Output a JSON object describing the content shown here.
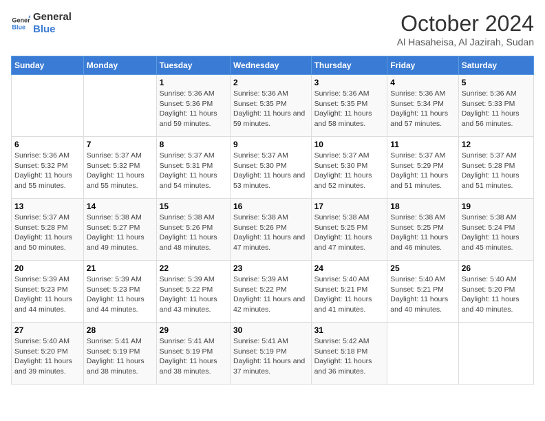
{
  "logo": {
    "line1": "General",
    "line2": "Blue"
  },
  "title": "October 2024",
  "subtitle": "Al Hasaheisa, Al Jazirah, Sudan",
  "columns": [
    "Sunday",
    "Monday",
    "Tuesday",
    "Wednesday",
    "Thursday",
    "Friday",
    "Saturday"
  ],
  "weeks": [
    [
      {
        "day": "",
        "sunrise": "",
        "sunset": "",
        "daylight": ""
      },
      {
        "day": "",
        "sunrise": "",
        "sunset": "",
        "daylight": ""
      },
      {
        "day": "1",
        "sunrise": "Sunrise: 5:36 AM",
        "sunset": "Sunset: 5:36 PM",
        "daylight": "Daylight: 11 hours and 59 minutes."
      },
      {
        "day": "2",
        "sunrise": "Sunrise: 5:36 AM",
        "sunset": "Sunset: 5:35 PM",
        "daylight": "Daylight: 11 hours and 59 minutes."
      },
      {
        "day": "3",
        "sunrise": "Sunrise: 5:36 AM",
        "sunset": "Sunset: 5:35 PM",
        "daylight": "Daylight: 11 hours and 58 minutes."
      },
      {
        "day": "4",
        "sunrise": "Sunrise: 5:36 AM",
        "sunset": "Sunset: 5:34 PM",
        "daylight": "Daylight: 11 hours and 57 minutes."
      },
      {
        "day": "5",
        "sunrise": "Sunrise: 5:36 AM",
        "sunset": "Sunset: 5:33 PM",
        "daylight": "Daylight: 11 hours and 56 minutes."
      }
    ],
    [
      {
        "day": "6",
        "sunrise": "Sunrise: 5:36 AM",
        "sunset": "Sunset: 5:32 PM",
        "daylight": "Daylight: 11 hours and 55 minutes."
      },
      {
        "day": "7",
        "sunrise": "Sunrise: 5:37 AM",
        "sunset": "Sunset: 5:32 PM",
        "daylight": "Daylight: 11 hours and 55 minutes."
      },
      {
        "day": "8",
        "sunrise": "Sunrise: 5:37 AM",
        "sunset": "Sunset: 5:31 PM",
        "daylight": "Daylight: 11 hours and 54 minutes."
      },
      {
        "day": "9",
        "sunrise": "Sunrise: 5:37 AM",
        "sunset": "Sunset: 5:30 PM",
        "daylight": "Daylight: 11 hours and 53 minutes."
      },
      {
        "day": "10",
        "sunrise": "Sunrise: 5:37 AM",
        "sunset": "Sunset: 5:30 PM",
        "daylight": "Daylight: 11 hours and 52 minutes."
      },
      {
        "day": "11",
        "sunrise": "Sunrise: 5:37 AM",
        "sunset": "Sunset: 5:29 PM",
        "daylight": "Daylight: 11 hours and 51 minutes."
      },
      {
        "day": "12",
        "sunrise": "Sunrise: 5:37 AM",
        "sunset": "Sunset: 5:28 PM",
        "daylight": "Daylight: 11 hours and 51 minutes."
      }
    ],
    [
      {
        "day": "13",
        "sunrise": "Sunrise: 5:37 AM",
        "sunset": "Sunset: 5:28 PM",
        "daylight": "Daylight: 11 hours and 50 minutes."
      },
      {
        "day": "14",
        "sunrise": "Sunrise: 5:38 AM",
        "sunset": "Sunset: 5:27 PM",
        "daylight": "Daylight: 11 hours and 49 minutes."
      },
      {
        "day": "15",
        "sunrise": "Sunrise: 5:38 AM",
        "sunset": "Sunset: 5:26 PM",
        "daylight": "Daylight: 11 hours and 48 minutes."
      },
      {
        "day": "16",
        "sunrise": "Sunrise: 5:38 AM",
        "sunset": "Sunset: 5:26 PM",
        "daylight": "Daylight: 11 hours and 47 minutes."
      },
      {
        "day": "17",
        "sunrise": "Sunrise: 5:38 AM",
        "sunset": "Sunset: 5:25 PM",
        "daylight": "Daylight: 11 hours and 47 minutes."
      },
      {
        "day": "18",
        "sunrise": "Sunrise: 5:38 AM",
        "sunset": "Sunset: 5:25 PM",
        "daylight": "Daylight: 11 hours and 46 minutes."
      },
      {
        "day": "19",
        "sunrise": "Sunrise: 5:38 AM",
        "sunset": "Sunset: 5:24 PM",
        "daylight": "Daylight: 11 hours and 45 minutes."
      }
    ],
    [
      {
        "day": "20",
        "sunrise": "Sunrise: 5:39 AM",
        "sunset": "Sunset: 5:23 PM",
        "daylight": "Daylight: 11 hours and 44 minutes."
      },
      {
        "day": "21",
        "sunrise": "Sunrise: 5:39 AM",
        "sunset": "Sunset: 5:23 PM",
        "daylight": "Daylight: 11 hours and 44 minutes."
      },
      {
        "day": "22",
        "sunrise": "Sunrise: 5:39 AM",
        "sunset": "Sunset: 5:22 PM",
        "daylight": "Daylight: 11 hours and 43 minutes."
      },
      {
        "day": "23",
        "sunrise": "Sunrise: 5:39 AM",
        "sunset": "Sunset: 5:22 PM",
        "daylight": "Daylight: 11 hours and 42 minutes."
      },
      {
        "day": "24",
        "sunrise": "Sunrise: 5:40 AM",
        "sunset": "Sunset: 5:21 PM",
        "daylight": "Daylight: 11 hours and 41 minutes."
      },
      {
        "day": "25",
        "sunrise": "Sunrise: 5:40 AM",
        "sunset": "Sunset: 5:21 PM",
        "daylight": "Daylight: 11 hours and 40 minutes."
      },
      {
        "day": "26",
        "sunrise": "Sunrise: 5:40 AM",
        "sunset": "Sunset: 5:20 PM",
        "daylight": "Daylight: 11 hours and 40 minutes."
      }
    ],
    [
      {
        "day": "27",
        "sunrise": "Sunrise: 5:40 AM",
        "sunset": "Sunset: 5:20 PM",
        "daylight": "Daylight: 11 hours and 39 minutes."
      },
      {
        "day": "28",
        "sunrise": "Sunrise: 5:41 AM",
        "sunset": "Sunset: 5:19 PM",
        "daylight": "Daylight: 11 hours and 38 minutes."
      },
      {
        "day": "29",
        "sunrise": "Sunrise: 5:41 AM",
        "sunset": "Sunset: 5:19 PM",
        "daylight": "Daylight: 11 hours and 38 minutes."
      },
      {
        "day": "30",
        "sunrise": "Sunrise: 5:41 AM",
        "sunset": "Sunset: 5:19 PM",
        "daylight": "Daylight: 11 hours and 37 minutes."
      },
      {
        "day": "31",
        "sunrise": "Sunrise: 5:42 AM",
        "sunset": "Sunset: 5:18 PM",
        "daylight": "Daylight: 11 hours and 36 minutes."
      },
      {
        "day": "",
        "sunrise": "",
        "sunset": "",
        "daylight": ""
      },
      {
        "day": "",
        "sunrise": "",
        "sunset": "",
        "daylight": ""
      }
    ]
  ]
}
